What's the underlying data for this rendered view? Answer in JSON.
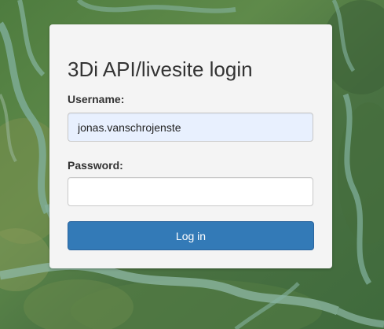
{
  "background": {
    "description_icon": "satellite-map-background"
  },
  "login": {
    "title": "3Di API/livesite login",
    "username_label": "Username:",
    "username_value": "jonas.vanschrojenste",
    "password_label": "Password:",
    "password_value": "",
    "submit_label": "Log in"
  },
  "colors": {
    "panel_bg": "#f4f4f4",
    "primary_button": "#337ab7",
    "autofill_bg": "#e8f0fe",
    "text": "#333333"
  }
}
